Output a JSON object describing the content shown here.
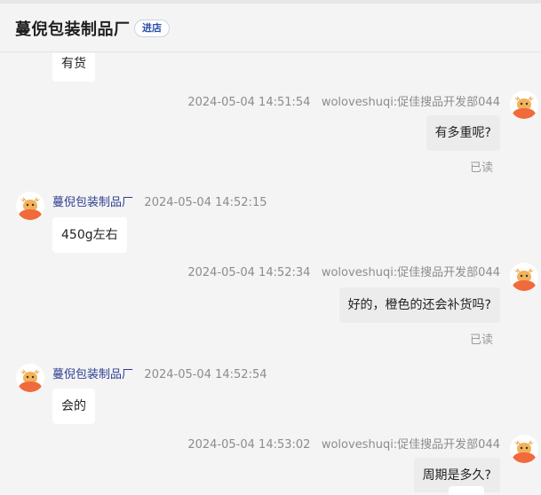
{
  "header": {
    "shop_name": "蔓倪包装制品厂",
    "enter_shop_label": "进店"
  },
  "messages": [
    {
      "side": "in",
      "text": "有货"
    },
    {
      "side": "out",
      "time": "2024-05-04 14:51:54",
      "sender": "woloveshuqi:促佳搜品开发部044",
      "text": "有多重呢?",
      "status": "已读"
    },
    {
      "side": "in",
      "sender": "蔓倪包装制品厂",
      "time": "2024-05-04 14:52:15",
      "text": "450g左右"
    },
    {
      "side": "out",
      "time": "2024-05-04 14:52:34",
      "sender": "woloveshuqi:促佳搜品开发部044",
      "text": "好的，橙色的还会补货吗?",
      "status": "已读"
    },
    {
      "side": "in",
      "sender": "蔓倪包装制品厂",
      "time": "2024-05-04 14:52:54",
      "text": "会的"
    },
    {
      "side": "out",
      "time": "2024-05-04 14:53:02",
      "sender": "woloveshuqi:促佳搜品开发部044",
      "text": "周期是多久?"
    }
  ],
  "colors": {
    "sender_name": "#2e3f8f",
    "avatar_accent": "#f06a3b"
  },
  "icons": {
    "avatar": "cartoon-moose-avatar-icon"
  }
}
